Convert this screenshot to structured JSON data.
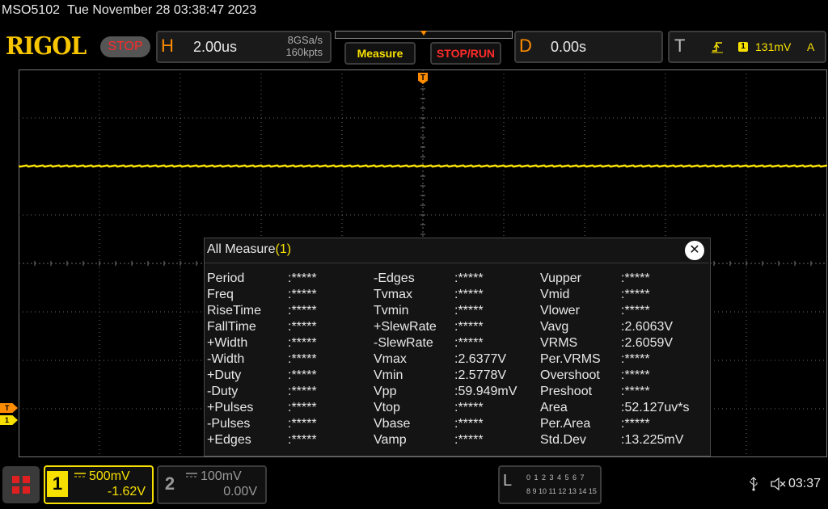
{
  "header": {
    "model": "MSO5102",
    "datetime": "Tue November 28 03:38:47 2023",
    "logo": "RIGOL",
    "run_state": "STOP"
  },
  "horizontal": {
    "letter": "H",
    "timebase": "2.00us",
    "sample_rate": "8GSa/s",
    "memory_depth": "160kpts"
  },
  "buttons": {
    "measure": "Measure",
    "stop_run": "STOP/RUN"
  },
  "delay": {
    "letter": "D",
    "value": "0.00s"
  },
  "trigger": {
    "letter": "T",
    "edge_icon": "rising-edge-icon",
    "source": "1",
    "level": "131mV",
    "mode": "A"
  },
  "screen": {
    "trigger_position_marker": "T",
    "trigger_level_marker": "T",
    "ch1_marker": "1",
    "trace_color": "#f7e000",
    "trace_level_div": 2.0
  },
  "measure_dialog": {
    "title": "All Measure",
    "source": "(1)",
    "columns": [
      [
        {
          "name": "Period",
          "value": ":*****"
        },
        {
          "name": "Freq",
          "value": ":*****"
        },
        {
          "name": "RiseTime",
          "value": ":*****"
        },
        {
          "name": "FallTime",
          "value": ":*****"
        },
        {
          "name": "+Width",
          "value": ":*****"
        },
        {
          "name": "-Width",
          "value": ":*****"
        },
        {
          "name": "+Duty",
          "value": ":*****"
        },
        {
          "name": "-Duty",
          "value": ":*****"
        },
        {
          "name": "+Pulses",
          "value": ":*****"
        },
        {
          "name": "-Pulses",
          "value": ":*****"
        },
        {
          "name": "+Edges",
          "value": ":*****"
        }
      ],
      [
        {
          "name": "-Edges",
          "value": ":*****"
        },
        {
          "name": "Tvmax",
          "value": ":*****"
        },
        {
          "name": "Tvmin",
          "value": ":*****"
        },
        {
          "name": "+SlewRate",
          "value": ":*****"
        },
        {
          "name": "-SlewRate",
          "value": ":*****"
        },
        {
          "name": "Vmax",
          "value": ":2.6377V"
        },
        {
          "name": "Vmin",
          "value": ":2.5778V"
        },
        {
          "name": "Vpp",
          "value": ":59.949mV"
        },
        {
          "name": "Vtop",
          "value": ":*****"
        },
        {
          "name": "Vbase",
          "value": ":*****"
        },
        {
          "name": "Vamp",
          "value": ":*****"
        }
      ],
      [
        {
          "name": "Vupper",
          "value": ":*****"
        },
        {
          "name": "Vmid",
          "value": ":*****"
        },
        {
          "name": "Vlower",
          "value": ":*****"
        },
        {
          "name": "Vavg",
          "value": ":2.6063V"
        },
        {
          "name": "VRMS",
          "value": ":2.6059V"
        },
        {
          "name": "Per.VRMS",
          "value": ":*****"
        },
        {
          "name": "Overshoot",
          "value": ":*****"
        },
        {
          "name": "Preshoot",
          "value": ":*****"
        },
        {
          "name": "Area",
          "value": ":52.127uv*s"
        },
        {
          "name": "Per.Area",
          "value": ":*****"
        },
        {
          "name": "Std.Dev",
          "value": ":13.225mV"
        }
      ]
    ]
  },
  "channels": {
    "ch1": {
      "number": "1",
      "scale": "500mV",
      "offset": "-1.62V",
      "coupling_icon": "dc-coupling-icon"
    },
    "ch2": {
      "number": "2",
      "scale": "100mV",
      "offset": "0.00V",
      "coupling_icon": "dc-coupling-icon"
    }
  },
  "logic_analyzer": {
    "letter": "L",
    "line1": "0 1 2 3  4 5 6 7",
    "line2": "8 9 10 11 12 13 14 15"
  },
  "status": {
    "usb_icon": "usb-icon",
    "sound_icon": "speaker-mute-icon",
    "time": "03:37"
  }
}
